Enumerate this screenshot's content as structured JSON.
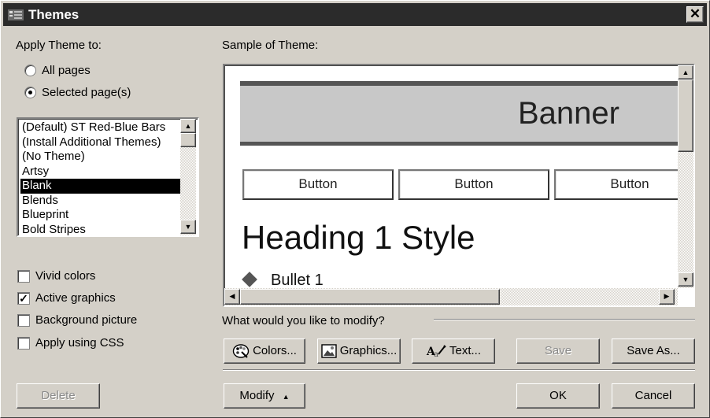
{
  "window": {
    "title": "Themes",
    "close_glyph": "✕"
  },
  "apply": {
    "label": "Apply Theme to:",
    "options": [
      {
        "label": "All pages",
        "checked": false
      },
      {
        "label": "Selected page(s)",
        "checked": true
      }
    ]
  },
  "theme_list": {
    "items": [
      "(Default) ST Red-Blue Bars",
      "(Install Additional Themes)",
      "(No Theme)",
      "Artsy",
      "Blank",
      "Blends",
      "Blueprint",
      "Bold Stripes"
    ],
    "selected": "Blank"
  },
  "options": {
    "vivid": {
      "label": "Vivid colors",
      "checked": false
    },
    "active": {
      "label": "Active graphics",
      "checked": true,
      "mark": "✓"
    },
    "background": {
      "label": "Background picture",
      "checked": false
    },
    "css": {
      "label": "Apply using CSS",
      "checked": false
    }
  },
  "sample": {
    "label": "Sample of Theme:",
    "banner": "Banner",
    "buttons": [
      "Button",
      "Button",
      "Button"
    ],
    "heading": "Heading 1 Style",
    "bullet": "Bullet 1"
  },
  "modify": {
    "question": "What would you like to modify?",
    "colors": "Colors...",
    "graphics": "Graphics...",
    "text": "Text...",
    "save": "Save",
    "save_as": "Save As..."
  },
  "footer": {
    "delete": "Delete",
    "modify": "Modify",
    "modify_arrow": "▲",
    "ok": "OK",
    "cancel": "Cancel"
  },
  "scroll_glyphs": {
    "up": "▲",
    "down": "▼",
    "left": "◀",
    "right": "▶"
  },
  "icons": {
    "app": "themes-app-icon",
    "palette": "palette-icon",
    "picture": "picture-icon",
    "text": "text-style-icon"
  }
}
